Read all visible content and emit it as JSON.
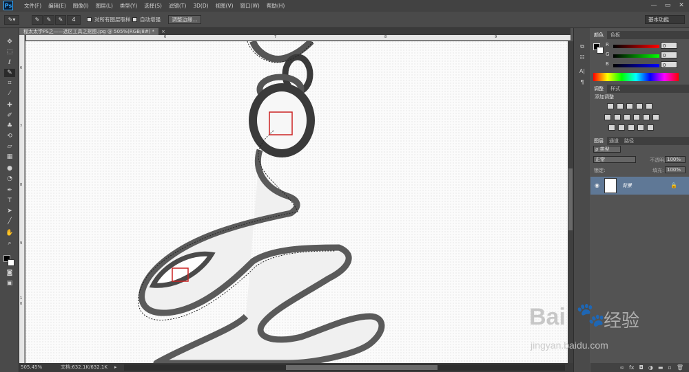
{
  "app": {
    "logo": "Ps"
  },
  "menu": [
    "文件(F)",
    "编辑(E)",
    "图像(I)",
    "图层(L)",
    "类型(Y)",
    "选择(S)",
    "滤镜(T)",
    "3D(D)",
    "视图(V)",
    "窗口(W)",
    "帮助(H)"
  ],
  "window_buttons": [
    "—",
    "▭",
    "✕"
  ],
  "options": {
    "brush_size": "4",
    "sample_all_layers": "对所有图层取样",
    "auto_enhance": "自动增强",
    "refine_edge": "调整边缘...",
    "workspace": "基本功能"
  },
  "document": {
    "tab_title": "程太太学PS之——选区工具之抠图.jpg @ 505%(RGB/8#) *",
    "tab_close": "×"
  },
  "ruler": {
    "top": [
      "6",
      "7",
      "8",
      "9"
    ],
    "left": [
      "6",
      "7",
      "8",
      "9",
      "1",
      "0"
    ]
  },
  "status": {
    "zoom": "505.45%",
    "doc": "文档:632.1K/632.1K"
  },
  "panels": {
    "color_tabs": [
      "颜色",
      "色板"
    ],
    "rgb": [
      {
        "label": "R",
        "value": "0",
        "gradient": "linear-gradient(to right,#000,#ff0000)"
      },
      {
        "label": "G",
        "value": "0",
        "gradient": "linear-gradient(to right,#000,#00ff00)"
      },
      {
        "label": "B",
        "value": "0",
        "gradient": "linear-gradient(to right,#000,#0000ff)"
      }
    ],
    "adjust_tabs": [
      "调整",
      "样式"
    ],
    "adjust_title": "添加调整",
    "layer_tabs": [
      "图层",
      "通道",
      "路径"
    ],
    "layer_filter": "ρ 类型",
    "blend_mode": "正常",
    "opacity_label": "不透明度:",
    "opacity_value": "100%",
    "lock_label": "锁定:",
    "fill_label": "填充:",
    "fill_value": "100%",
    "layer_name": "背景"
  },
  "watermark": {
    "brand_left": "Bai",
    "brand_right": "经验",
    "url": "jingyan.baidu.com"
  },
  "colors": {
    "selection_box": "#cc2222",
    "layer_selected": "#5f7896"
  }
}
